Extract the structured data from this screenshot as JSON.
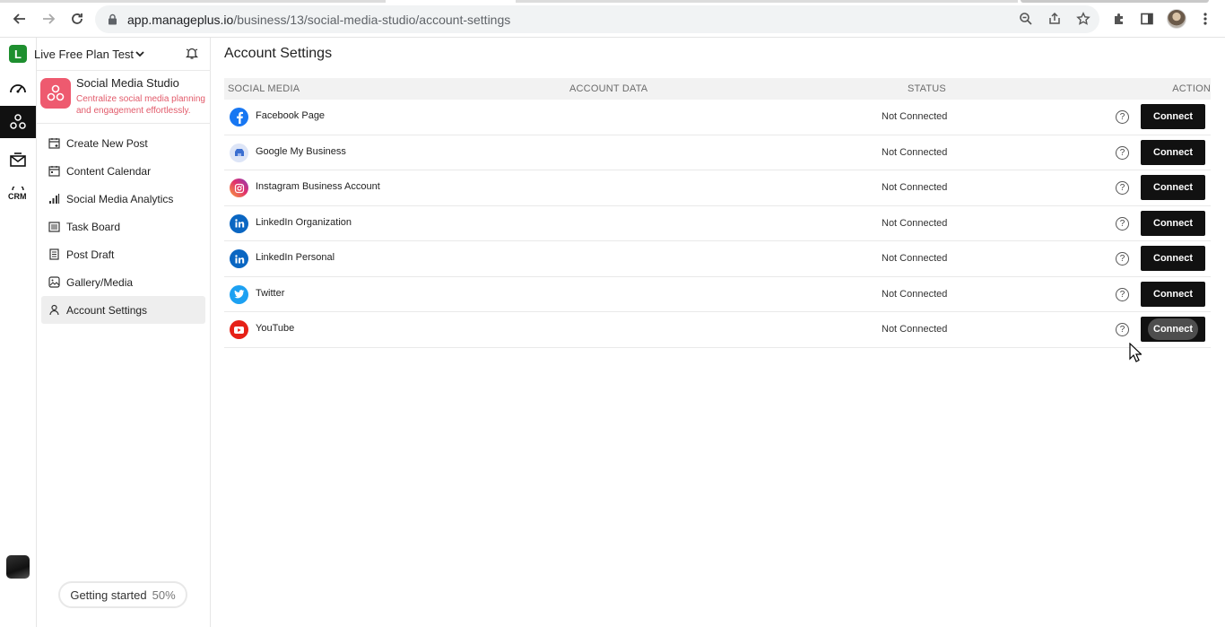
{
  "browser": {
    "url_host": "app.manageplus.io",
    "url_path": "/business/13/social-media-studio/account-settings"
  },
  "workspace": {
    "plan_name": "Live Free Plan Test",
    "plan_logo_letter": "L"
  },
  "studio": {
    "title": "Social Media Studio",
    "description": "Centralize social media planning and engagement effortlessly."
  },
  "menu": [
    {
      "label": "Create New Post",
      "icon": "calendar-plus-icon"
    },
    {
      "label": "Content Calendar",
      "icon": "calendar-icon"
    },
    {
      "label": "Social Media Analytics",
      "icon": "bar-chart-icon"
    },
    {
      "label": "Task Board",
      "icon": "task-list-icon"
    },
    {
      "label": "Post Draft",
      "icon": "document-icon"
    },
    {
      "label": "Gallery/Media",
      "icon": "image-icon"
    },
    {
      "label": "Account Settings",
      "icon": "user-icon",
      "active": true
    }
  ],
  "getting_started": {
    "label": "Getting started",
    "percent": "50%"
  },
  "page": {
    "title": "Account Settings"
  },
  "table": {
    "headers": {
      "social": "SOCIAL MEDIA",
      "account": "ACCOUNT DATA",
      "status": "STATUS",
      "action": "ACTION"
    },
    "rows": [
      {
        "name": "Facebook Page",
        "status": "Not Connected",
        "action": "Connect",
        "icon": "facebook-icon",
        "color": "#1877f2"
      },
      {
        "name": "Google My Business",
        "status": "Not Connected",
        "action": "Connect",
        "icon": "google-my-business-icon",
        "color": "#3b6fd1"
      },
      {
        "name": "Instagram Business Account",
        "status": "Not Connected",
        "action": "Connect",
        "icon": "instagram-icon",
        "color": "#e1306c"
      },
      {
        "name": "LinkedIn Organization",
        "status": "Not Connected",
        "action": "Connect",
        "icon": "linkedin-icon",
        "color": "#0a66c2"
      },
      {
        "name": "LinkedIn Personal",
        "status": "Not Connected",
        "action": "Connect",
        "icon": "linkedin-icon",
        "color": "#0a66c2"
      },
      {
        "name": "Twitter",
        "status": "Not Connected",
        "action": "Connect",
        "icon": "twitter-icon",
        "color": "#1da1f2"
      },
      {
        "name": "YouTube",
        "status": "Not Connected",
        "action": "Connect",
        "icon": "youtube-icon",
        "color": "#e62117"
      }
    ]
  },
  "colors": {
    "brand_studio": "#ee5a6f",
    "button_dark": "#111111",
    "plan_green": "#1e8f2f"
  }
}
